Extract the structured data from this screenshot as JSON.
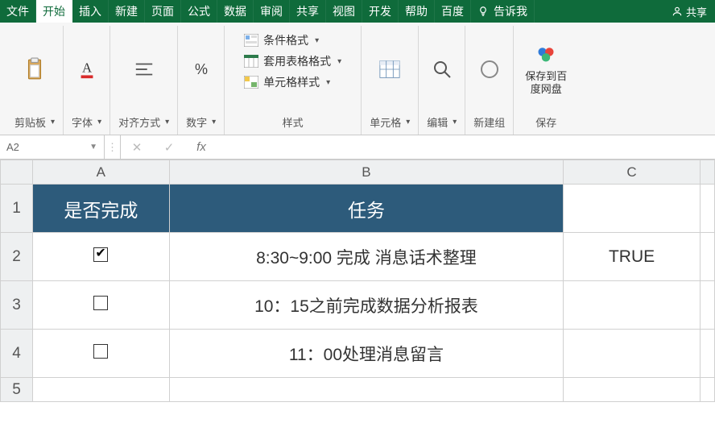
{
  "menu": {
    "tabs": [
      "文件",
      "开始",
      "插入",
      "新建",
      "页面",
      "公式",
      "数据",
      "审阅",
      "共享",
      "视图",
      "开发",
      "帮助",
      "百度"
    ],
    "active_index": 1,
    "tellme_icon": "lightbulb-icon",
    "tellme": "告诉我",
    "share_icon": "person-icon",
    "share": "共享"
  },
  "ribbon": {
    "clipboard": {
      "label": "剪贴板"
    },
    "font": {
      "label": "字体"
    },
    "align": {
      "label": "对齐方式"
    },
    "number": {
      "label": "数字"
    },
    "styles": {
      "cond": "条件格式",
      "table": "套用表格格式",
      "cell": "单元格样式",
      "label": "样式"
    },
    "cells": {
      "label": "单元格"
    },
    "editing": {
      "label": "编辑"
    },
    "newgrp": {
      "label": "新建组"
    },
    "baidu": {
      "big": "保存到百度网盘",
      "label": "保存"
    }
  },
  "fx": {
    "namebox": "A2",
    "formula": ""
  },
  "sheet": {
    "cols": [
      "A",
      "B",
      "C"
    ],
    "rows": [
      "1",
      "2",
      "3",
      "4",
      "5"
    ],
    "headers": {
      "a": "是否完成",
      "b": "任务"
    },
    "data": [
      {
        "checked": true,
        "task": "8:30~9:00 完成 消息话术整理",
        "c": "TRUE"
      },
      {
        "checked": false,
        "task": "10：15之前完成数据分析报表",
        "c": ""
      },
      {
        "checked": false,
        "task": "11：00处理消息留言",
        "c": ""
      }
    ]
  }
}
